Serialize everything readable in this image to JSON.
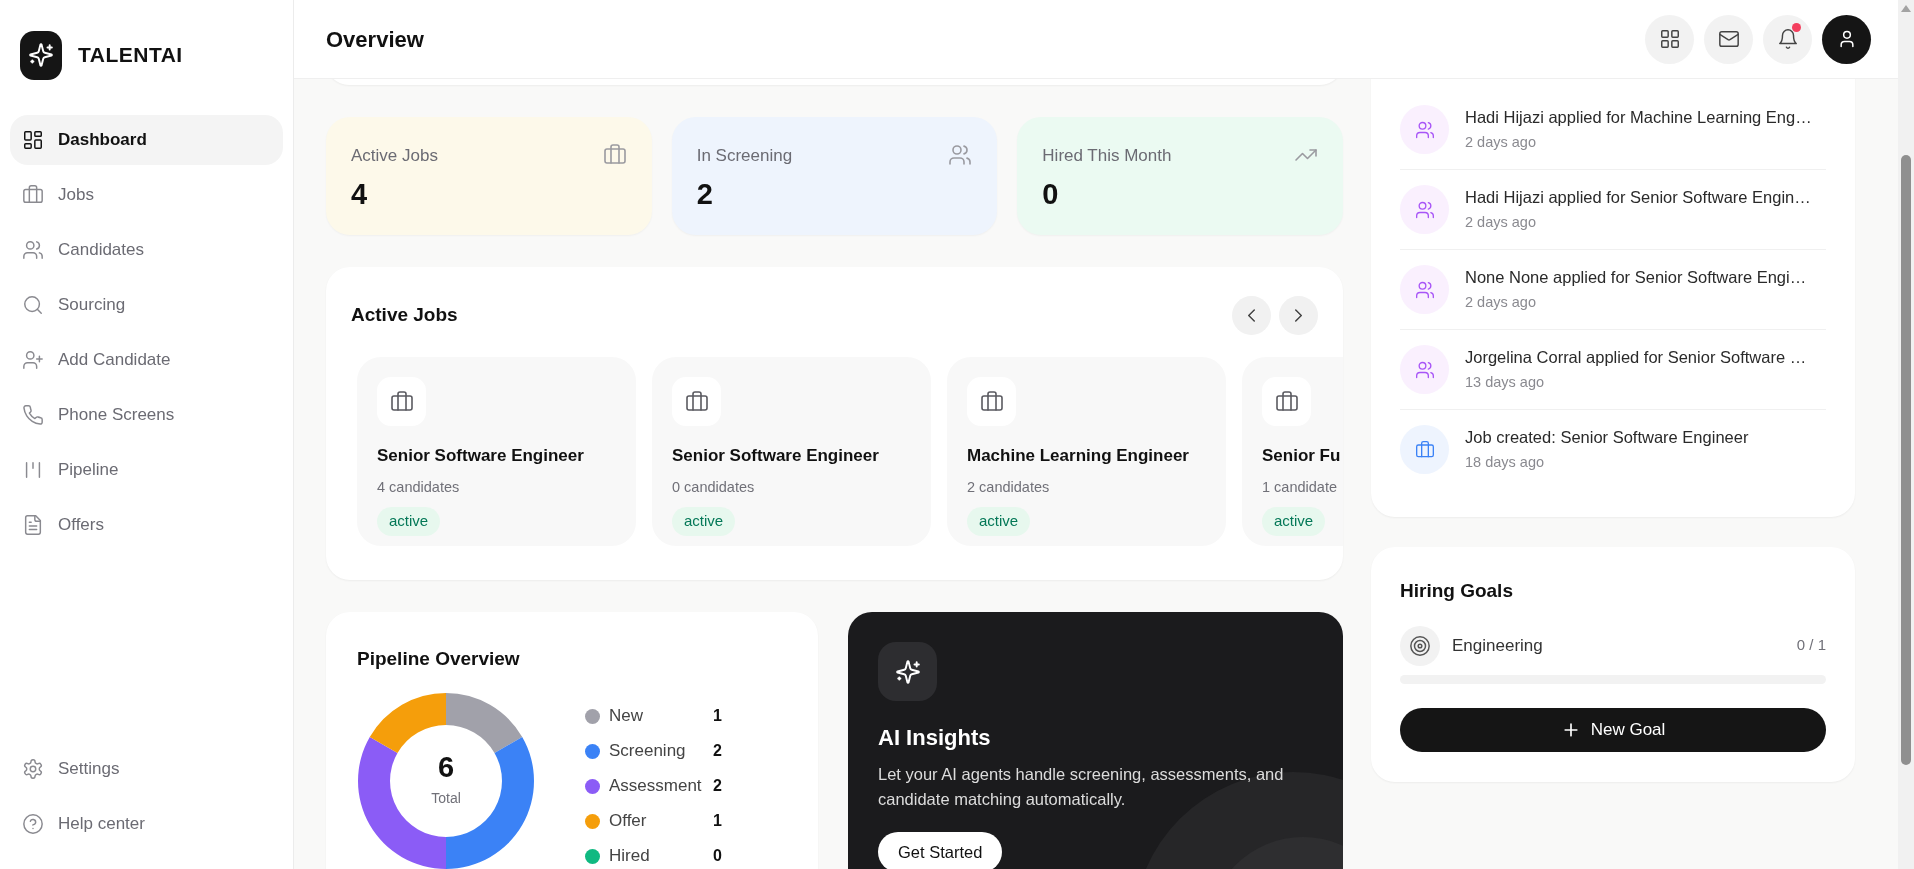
{
  "sidebar": {
    "brand": "TALENTAI",
    "items": [
      {
        "label": "Dashboard",
        "selected": true
      },
      {
        "label": "Jobs",
        "selected": false
      },
      {
        "label": "Candidates",
        "selected": false
      },
      {
        "label": "Sourcing",
        "selected": false
      },
      {
        "label": "Add Candidate",
        "selected": false
      },
      {
        "label": "Phone Screens",
        "selected": false
      },
      {
        "label": "Pipeline",
        "selected": false
      },
      {
        "label": "Offers",
        "selected": false
      }
    ],
    "footer_items": [
      {
        "label": "Settings"
      },
      {
        "label": "Help center"
      }
    ]
  },
  "header": {
    "title": "Overview",
    "notifications_unread": true
  },
  "stats": [
    {
      "label": "Active Jobs",
      "value": "4"
    },
    {
      "label": "In Screening",
      "value": "2"
    },
    {
      "label": "Hired This Month",
      "value": "0"
    }
  ],
  "active_jobs": {
    "title": "Active Jobs",
    "jobs": [
      {
        "title": "Senior Software Engineer",
        "candidates": "4 candidates",
        "status": "active"
      },
      {
        "title": "Senior Software Engineer",
        "candidates": "0 candidates",
        "status": "active"
      },
      {
        "title": "Machine Learning Engineer",
        "candidates": "2 candidates",
        "status": "active"
      },
      {
        "title": "Senior Fu",
        "candidates": "1 candidate",
        "status": "active"
      }
    ]
  },
  "pipeline": {
    "title": "Pipeline Overview",
    "total": "6",
    "total_label": "Total",
    "legend": [
      {
        "count": "1",
        "color": "#a1a1aa"
      },
      {
        "count": "2",
        "color": "#3b82f6"
      },
      {
        "count": "2",
        "color": "#8b5cf6"
      },
      {
        "count": "1",
        "color": "#f59e0b"
      },
      {
        "count": "0",
        "color": "#10b981"
      }
    ],
    "chart_data": {
      "type": "donut",
      "categories": [
        "New",
        "Screening",
        "Assessment",
        "Offer",
        "Hired"
      ],
      "values": [
        16.67,
        33.33,
        33.33,
        16.67,
        0
      ]
    }
  },
  "ai_insights": {
    "title": "AI Insights",
    "text": "Let your AI agents handle screening, assessments, and candidate matching automatically.",
    "button": "Get Started"
  },
  "activity": [
    {
      "kind": "application",
      "text": "Hadi Hijazi applied for Machine Learning Eng…",
      "time": "2 days ago"
    },
    {
      "kind": "application",
      "text": "Hadi Hijazi applied for Senior Software Engin…",
      "time": "2 days ago"
    },
    {
      "kind": "application",
      "text": "None None applied for Senior Software Engi…",
      "time": "2 days ago"
    },
    {
      "kind": "application",
      "text": "Jorgelina Corral applied for Senior Software …",
      "time": "13 days ago"
    },
    {
      "kind": "job",
      "text": "Job created: Senior Software Engineer",
      "time": "18 days ago"
    }
  ],
  "hiring_goals": {
    "title": "Hiring Goals",
    "goals": [
      {
        "name": "Engineering",
        "progress": "0 / 1",
        "level": 0
      }
    ],
    "button": "New Goal"
  }
}
